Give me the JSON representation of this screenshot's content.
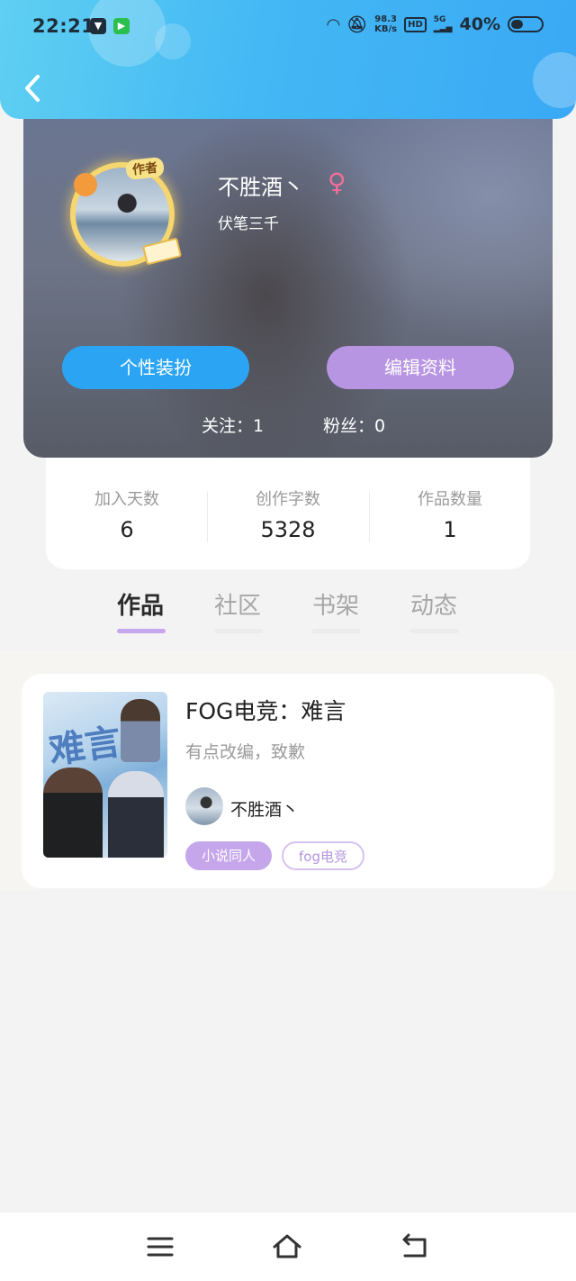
{
  "status_bar": {
    "time": "22:21",
    "net_speed_value": "98.3",
    "net_speed_unit": "KB/s",
    "hd_label": "HD",
    "network_label": "5G",
    "battery_text": "40%",
    "battery_level": 0.4
  },
  "profile": {
    "username": "不胜酒丶",
    "gender_symbol": "♀",
    "signature": "伏笔三千",
    "avatar_badge": "作者",
    "dress_button": "个性装扮",
    "edit_button": "编辑资料",
    "follows_label": "关注：1",
    "fans_label": "粉丝：0"
  },
  "stats": [
    {
      "label": "加入天数",
      "value": "6"
    },
    {
      "label": "创作字数",
      "value": "5328"
    },
    {
      "label": "作品数量",
      "value": "1"
    }
  ],
  "tabs": [
    {
      "label": "作品",
      "active": true
    },
    {
      "label": "社区",
      "active": false
    },
    {
      "label": "书架",
      "active": false
    },
    {
      "label": "动态",
      "active": false
    }
  ],
  "works": [
    {
      "title": "FOG电竞：难言",
      "description": "有点改编，致歉",
      "author": "不胜酒丶",
      "tags": [
        "小说同人",
        "fog电竞"
      ]
    }
  ],
  "colors": {
    "accent_blue": "#2ba5f3",
    "accent_purple": "#b895e2",
    "gender_pink": "#f06f9a"
  },
  "icons": {
    "back": "chevron-left-icon",
    "nav_menu": "menu-icon",
    "nav_home": "home-icon",
    "nav_back": "return-icon"
  }
}
